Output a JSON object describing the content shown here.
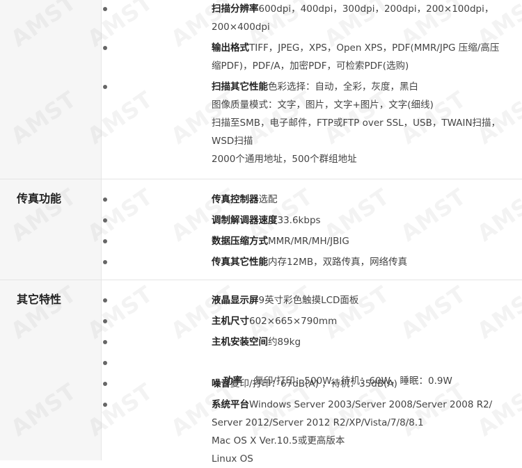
{
  "scan_section": {
    "items": [
      {
        "label": "扫描分辨率",
        "lines": [
          "600dpi，400dpi，300dpi，200dpi，200×100dpi，",
          "200×400dpi"
        ]
      },
      {
        "label": "输出格式",
        "lines": [
          "TIFF，JPEG，XPS，Open XPS，PDF(MMR/JPG 压缩/高压",
          "缩PDF)，PDF/A，加密PDF，可检索PDF(选购)"
        ]
      },
      {
        "label": "扫描其它性能",
        "lines": [
          "色彩选择：自动，全彩，灰度，黑白",
          "图像质量模式：文字，图片，文字+图片，文字(细线)",
          "扫描至SMB，电子邮件，FTP或FTP over SSL，USB，TWAIN扫描，",
          "WSD扫描",
          "2000个通用地址，500个群组地址"
        ]
      }
    ]
  },
  "fax_section": {
    "title": "传真功能",
    "items": [
      {
        "label": "传真控制器",
        "value": "选配"
      },
      {
        "label": "调制解调器速度",
        "value": "33.6kbps"
      },
      {
        "label": "数据压缩方式",
        "value": "MMR/MR/MH/JBIG"
      },
      {
        "label": "传真其它性能",
        "value": "内存12MB，双路传真，网络传真"
      }
    ]
  },
  "other_section": {
    "title": "其它特性",
    "items": [
      {
        "label": "液晶显示屏",
        "lines": [
          "9英寸彩色触摸LCD面板"
        ]
      },
      {
        "label": "主机尺寸",
        "lines": [
          "602×665×790mm"
        ]
      },
      {
        "label": "主机安装空间",
        "lines": [
          "约89kg"
        ]
      },
      {
        "label": "功率",
        "lines": [
          "    复印/打印：500W，待机：60W，睡眠：0.9W"
        ]
      },
      {
        "label": "噪音",
        "lines": [
          "复印/打印：67dB(A) ，待机：35dB(A)"
        ]
      },
      {
        "label": "系统平台",
        "lines": [
          "Windows Server 2003/Server 2008/Server 2008 R2/",
          "Server 2012/Server 2012 R2/XP/Vista/7/8/8.1",
          "Mac OS X Ver.10.5或更高版本",
          "Linux OS"
        ]
      }
    ]
  },
  "watermark": "AMST"
}
